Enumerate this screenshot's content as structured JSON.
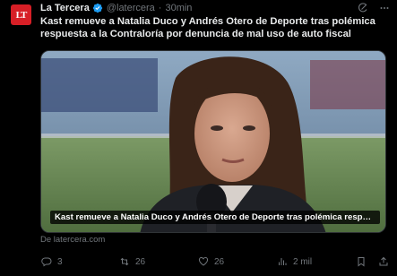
{
  "tweet": {
    "author_name": "La Tercera",
    "avatar_text": "LT",
    "handle": "@latercera",
    "separator": "·",
    "time": "30min",
    "text": "Kast remueve a Natalia Duco y Andrés Otero de Deporte tras polémica respuesta a la Contraloría por denuncia de mal uso de auto fiscal",
    "media_caption": "Kast remueve a Natalia Duco y Andrés Otero de Deporte tras polémica respue...",
    "source": "De latercera.com"
  },
  "actions": {
    "reply_count": "3",
    "retweet_count": "26",
    "like_count": "26",
    "views_count": "2 mil"
  },
  "colors": {
    "background": "#000000",
    "text": "#e7e9ea",
    "muted": "#71767b",
    "verified": "#1d9bf0",
    "avatar_bg": "#d71f26"
  },
  "icons": [
    "verified-badge-icon",
    "grok-icon",
    "more-icon",
    "reply-icon",
    "retweet-icon",
    "like-icon",
    "views-icon",
    "bookmark-icon",
    "share-icon"
  ]
}
